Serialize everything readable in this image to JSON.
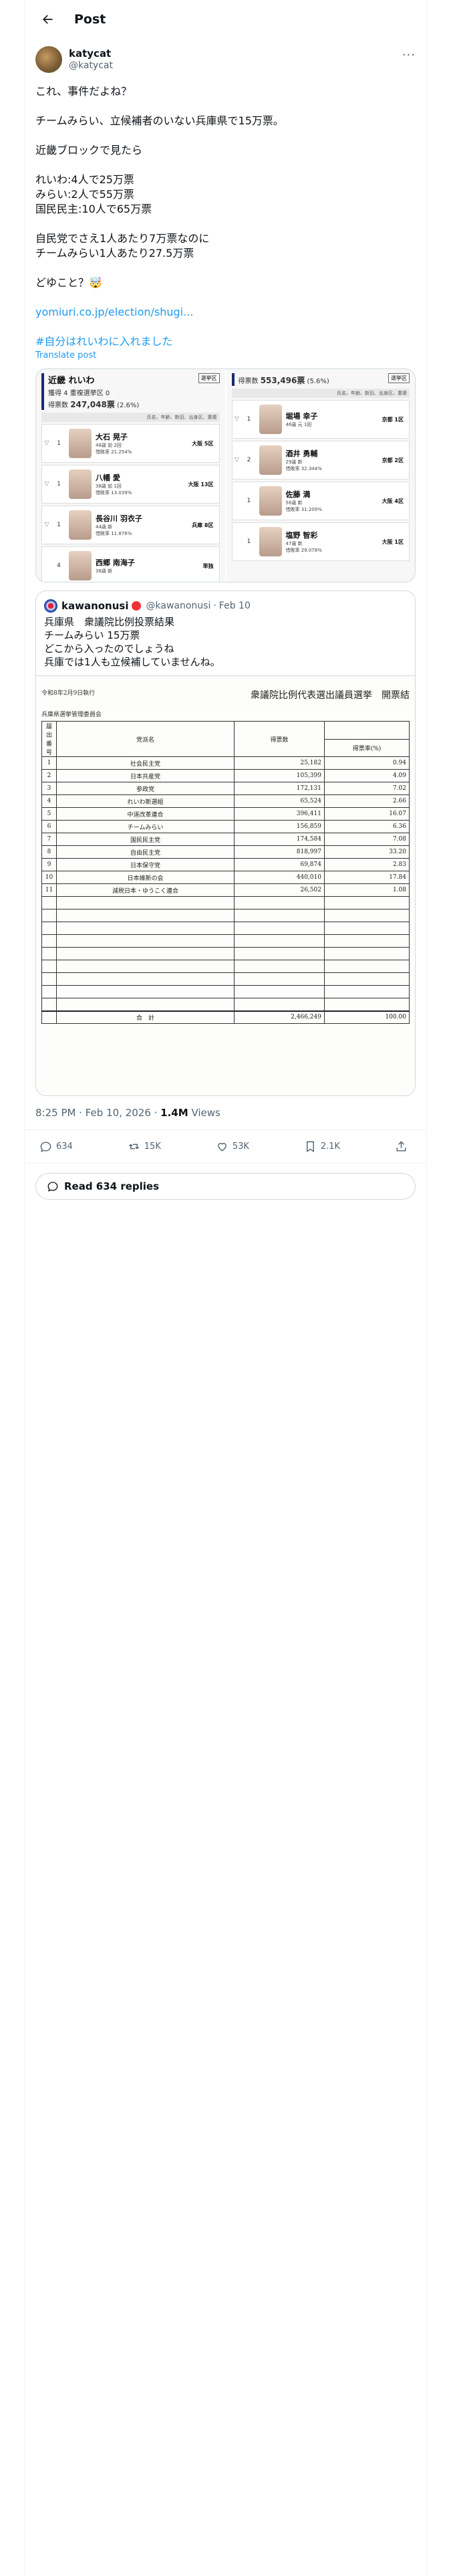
{
  "header": {
    "title": "Post"
  },
  "author": {
    "display_name": "katycat",
    "handle": "@katycat"
  },
  "post": {
    "lines": [
      "これ、事件だよね？",
      "",
      "チームみらい、立候補者のいない兵庫県で15万票。",
      "",
      "近畿ブロックで見たら",
      "",
      "れいわ:4人で25万票",
      "みらい:2人で55万票",
      "国民民主:10人で65万票",
      "",
      "自民党でさえ1人あたり7万票なのに",
      "チームみらい1人あたり27.5万票",
      "",
      "どゆこと？🤯"
    ],
    "link": "yomiuri.co.jp/election/shugi...",
    "hashtag": "#自分はれいわに入れました",
    "translate": "Translate post"
  },
  "media": {
    "left": {
      "party": "近畿 れいわ",
      "sub": "獲得 4 重複選挙区 0",
      "votes_label": "得票数",
      "votes": "247,048票",
      "share": "(2.6%)",
      "button": "選挙区",
      "filter": "氏名、年齢、新旧、出身区、重複",
      "candidates": [
        {
          "rank": "1",
          "name": "大石 晃子",
          "meta": "48歳 前 2回",
          "rate": "惜敗率 21.254%",
          "area": "大阪 5区"
        },
        {
          "rank": "1",
          "name": "八幡 愛",
          "meta": "38歳 前 1回",
          "rate": "惜敗率 13.039%",
          "area": "大阪 13区"
        },
        {
          "rank": "1",
          "name": "長谷川 羽衣子",
          "meta": "44歳 新",
          "rate": "惜敗率 11.876%",
          "area": "兵庫 8区"
        },
        {
          "rank": "4",
          "name": "西郷 南海子",
          "meta": "38歳 新",
          "rate": "",
          "area": "単独"
        }
      ]
    },
    "right": {
      "votes_label": "得票数",
      "votes": "553,496票",
      "share": "(5.6%)",
      "button": "選挙区",
      "filter": "氏名、年齢、新旧、出身区、重複",
      "candidates": [
        {
          "rank": "1",
          "name": "堀場 幸子",
          "meta": "46歳 元 1回",
          "rate": "",
          "area": "京都 1区"
        },
        {
          "rank": "2",
          "name": "酒井 勇輔",
          "meta": "29歳 新",
          "rate": "惜敗率 32.344%",
          "area": "京都 2区"
        },
        {
          "rank": "1",
          "name": "佐藤 満",
          "meta": "56歳 新",
          "rate": "惜敗率 31.209%",
          "area": "大阪 4区"
        },
        {
          "rank": "1",
          "name": "塩野 智彩",
          "meta": "47歳 新",
          "rate": "惜敗率 29.078%",
          "area": "大阪 1区"
        }
      ]
    }
  },
  "quote": {
    "name": "kawanonusi",
    "handle": "@kawanonusi",
    "date": "Feb 10",
    "lines": [
      "兵庫県　衆議院比例投票結果",
      "チームみらい 15万票",
      "どこから入ったのでしょうね",
      "兵庫では1人も立候補していませんね。"
    ],
    "doc": {
      "date": "令和8年2月9日執行",
      "title": "衆議院比例代表選出議員選挙　開票結",
      "committee": "兵庫県選挙管理委員会",
      "col_no": "届出番号",
      "col_party": "党派名",
      "col_votes": "得票数",
      "col_rate": "得票率(%)",
      "rows": [
        {
          "no": "1",
          "party": "社会民主党",
          "votes": "25,182",
          "rate": "0.94"
        },
        {
          "no": "2",
          "party": "日本共産党",
          "votes": "105,399",
          "rate": "4.09"
        },
        {
          "no": "3",
          "party": "参政党",
          "votes": "172,131",
          "rate": "7.02"
        },
        {
          "no": "4",
          "party": "れいわ新選組",
          "votes": "65,524",
          "rate": "2.66"
        },
        {
          "no": "5",
          "party": "中道改革連合",
          "votes": "396,411",
          "rate": "16.07"
        },
        {
          "no": "6",
          "party": "チームみらい",
          "votes": "156,859",
          "rate": "6.36"
        },
        {
          "no": "7",
          "party": "国民民主党",
          "votes": "174,584",
          "rate": "7.08"
        },
        {
          "no": "8",
          "party": "自由民主党",
          "votes": "818,997",
          "rate": "33.20"
        },
        {
          "no": "9",
          "party": "日本保守党",
          "votes": "69,874",
          "rate": "2.83"
        },
        {
          "no": "10",
          "party": "日本維新の会",
          "votes": "440,010",
          "rate": "17.84"
        },
        {
          "no": "11",
          "party": "減税日本・ゆうこく連合",
          "votes": "26,502",
          "rate": "1.08"
        }
      ],
      "total_label": "合　計",
      "total_votes": "2,466,249",
      "total_rate": "100.00"
    }
  },
  "meta": {
    "time": "8:25 PM · Feb 10, 2026 · ",
    "views_count": "1.4M",
    "views_label": " Views"
  },
  "actions": {
    "replies": "634",
    "reposts": "15K",
    "likes": "53K",
    "bookmarks": "2.1K"
  },
  "read_replies": "Read 634 replies"
}
